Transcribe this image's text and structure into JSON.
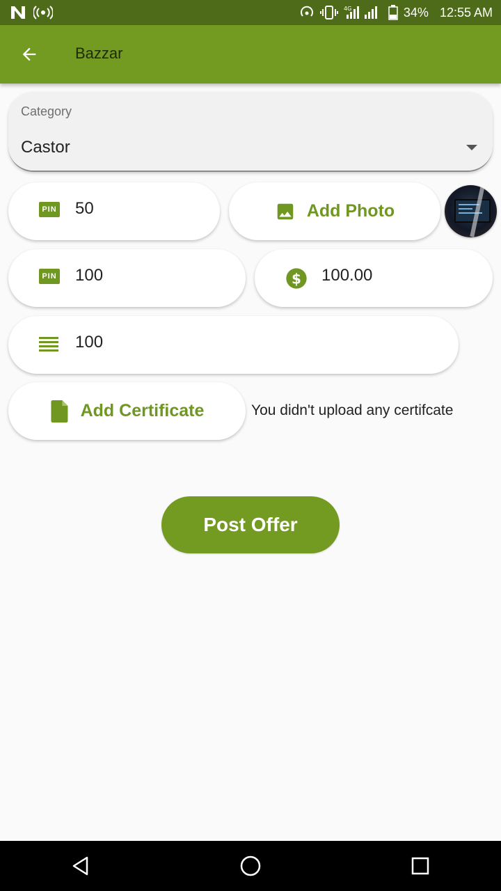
{
  "status_bar": {
    "battery": "34%",
    "time": "12:55 AM",
    "network": "4G"
  },
  "app_bar": {
    "title": "Bazzar"
  },
  "form": {
    "category": {
      "label": "Category",
      "value": "Castor"
    },
    "pin_field_1": {
      "value": "50",
      "icon": "pin-icon"
    },
    "add_photo": {
      "label": "Add Photo",
      "icon": "image-icon"
    },
    "pin_field_2": {
      "value": "100",
      "icon": "pin-icon"
    },
    "price_field": {
      "value": "100.00",
      "icon": "dollar-icon"
    },
    "quantity_field": {
      "value": "100",
      "icon": "lines-icon"
    },
    "add_certificate": {
      "label": "Add Certificate",
      "icon": "file-icon"
    },
    "certificate_note": "You didn't upload any certifcate",
    "post_button": "Post Offer"
  },
  "colors": {
    "primary": "#739b22",
    "status_bar": "#4e6b1a",
    "accent_text": "#6f9722"
  }
}
